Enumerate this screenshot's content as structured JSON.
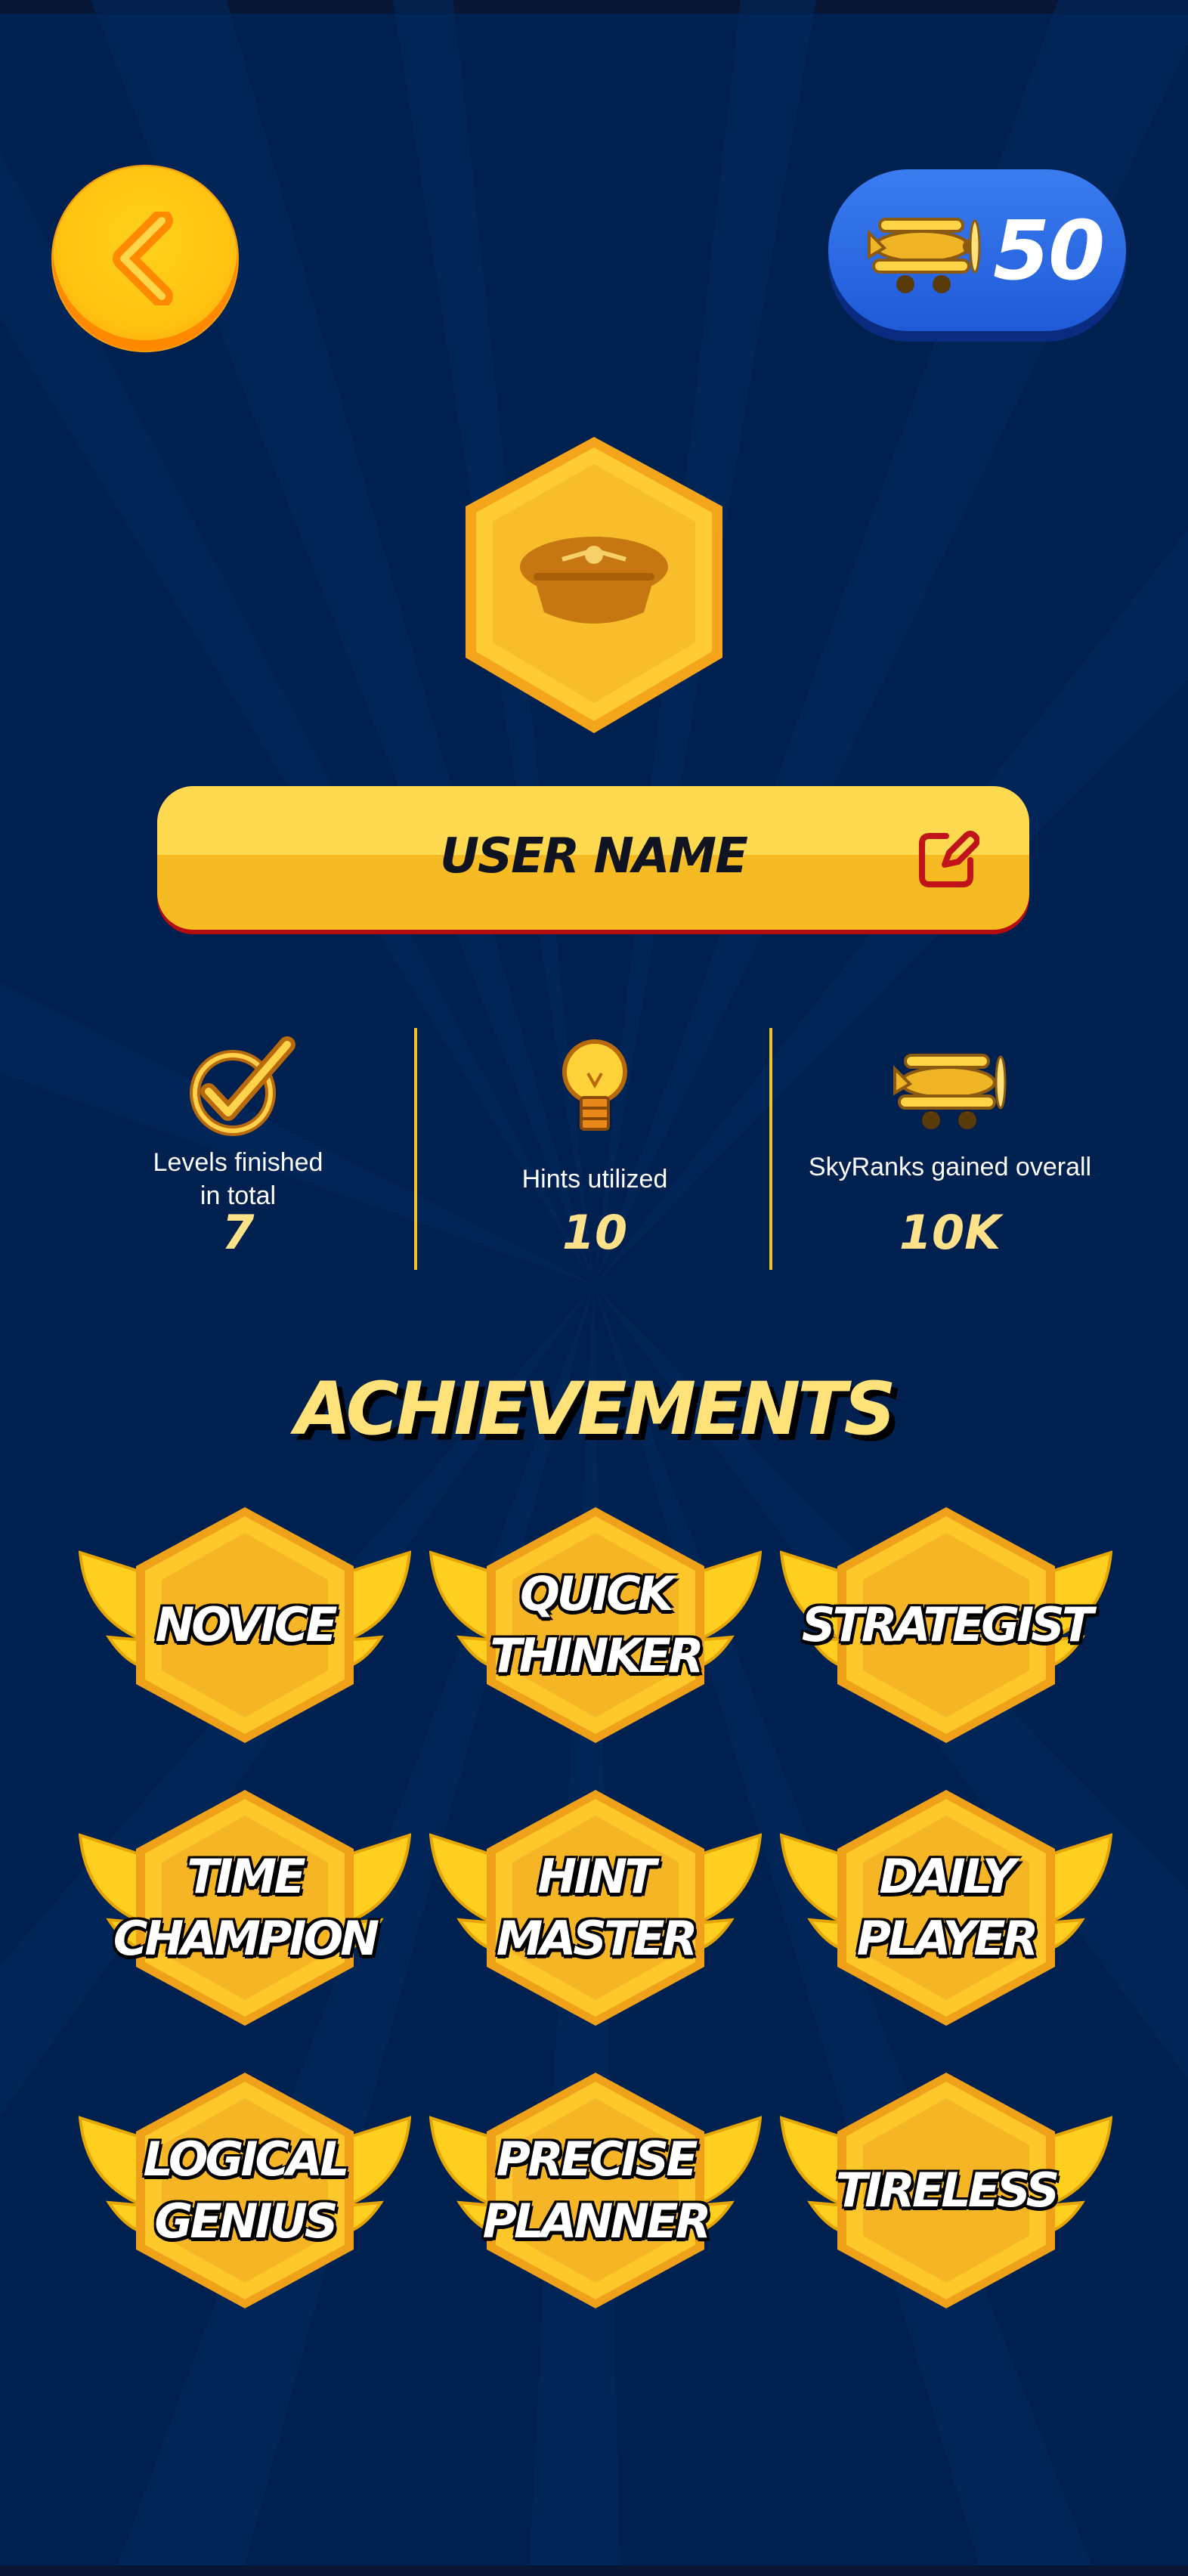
{
  "header": {
    "back_icon": "chevron-left-icon",
    "coins": {
      "icon": "biplane-icon",
      "value": "50"
    }
  },
  "profile": {
    "avatar_icon": "pilot-cap-icon",
    "user_name": "USER NAME",
    "edit_icon": "edit-pencil-icon"
  },
  "stats": [
    {
      "icon": "checkmark-icon",
      "label": "Levels finished\nin total",
      "value": "7"
    },
    {
      "icon": "lightbulb-icon",
      "label": "Hints utilized",
      "value": "10"
    },
    {
      "icon": "biplane-icon",
      "label": "SkyRanks gained overall",
      "value": "10K"
    }
  ],
  "achievements": {
    "title": "ACHIEVEMENTS",
    "badges": [
      {
        "label": "NOVICE"
      },
      {
        "label": "QUICK\nTHINKER"
      },
      {
        "label": "STRATEGIST"
      },
      {
        "label": "TIME\nCHAMPION"
      },
      {
        "label": "HINT\nMASTER"
      },
      {
        "label": "DAILY\nPLAYER"
      },
      {
        "label": "LOGICAL\nGENIUS"
      },
      {
        "label": "PRECISE\nPLANNER"
      },
      {
        "label": "TIRELESS"
      }
    ]
  },
  "colors": {
    "background": "#00204f",
    "gold": "#f6bb22",
    "accent_text": "#ffe27a",
    "pill_blue": "#1f5ad8",
    "name_bar_shadow": "#b50d0d"
  }
}
